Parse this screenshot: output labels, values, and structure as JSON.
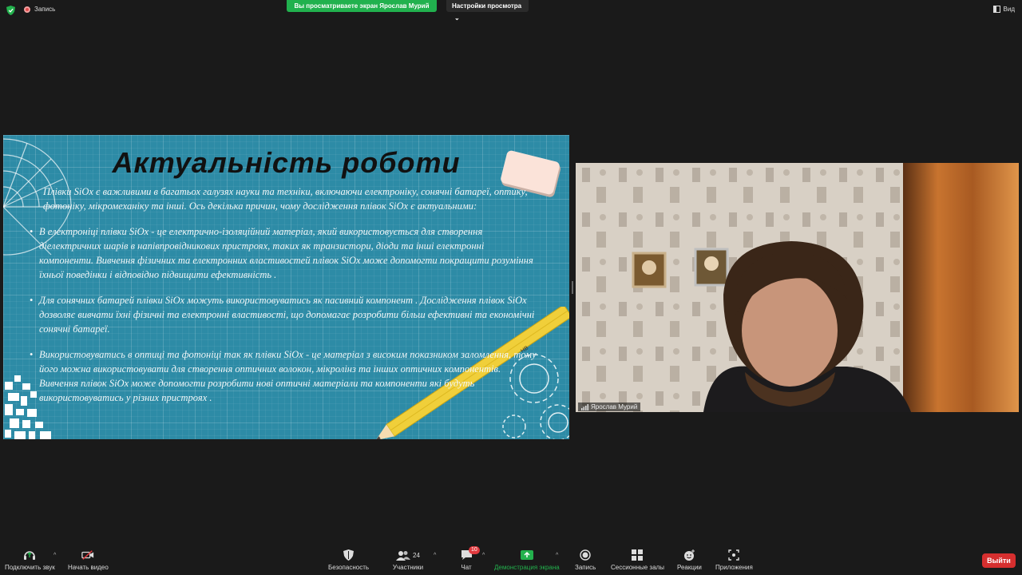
{
  "topbar": {
    "recording_label": "Запись",
    "share_banner": "Вы просматриваете экран Ярослав Мурий",
    "view_options_label": "Настройки просмотра",
    "view_label": "Вид"
  },
  "slide": {
    "title": "Актуальність  роботи",
    "intro": "Плівки SiOx є важливими в багатьох галузях науки та техніки, включаючи електроніку, сонячні батареї, оптику, фотоніку, мікромеханіку та інші. Ось декілька причин, чому дослідження плівок SiOx є актуальними:",
    "bullet_1": "В електроніці плівки  SiOx - це електрично-ізоляційний матеріал, який використовується для створення діелектричних шарів в напівпровідникових пристроях, таких як транзистори, діоди та інші електронні компоненти. Вивчення фізичних та електронних властивостей плівок SiOx може допомогти покращити розуміння їхньої поведінки і відповідно підвищити ефективність .",
    "bullet_2": "Для сонячних батарей плівки SiOx можуть використовуватись як пасивний компонент . Дослідження плівок SiOx дозволяє вивчати їхні фізичні та електронні властивості, що допомагає розробити більш ефективні та економічні сонячні батареї.",
    "bullet_3": "Використовуватись в оптиці та фотоніці так як плівки SiOx - це матеріал з високим показником заломлення, тому його можна використовувати для створення оптичних волокон, мікролінз та інших оптичних компонентів. Вивчення плівок SiOx може допомогти розробити нові оптичні матеріали та компоненти які будуть використовуватись у різних пристроях .",
    "pencil_label": "HB"
  },
  "video": {
    "participant_name": "Ярослав Мурий"
  },
  "toolbar": {
    "audio_label": "Подключить звук",
    "video_label": "Начать видео",
    "security_label": "Безопасность",
    "participants_label": "Участники",
    "participants_count": "24",
    "chat_label": "Чат",
    "chat_badge": "10",
    "share_label": "Демонстрация экрана",
    "record_label": "Запись",
    "breakout_label": "Сессионные залы",
    "reactions_label": "Реакции",
    "apps_label": "Приложения",
    "leave_label": "Выйти"
  },
  "colors": {
    "share_green": "#21b14e",
    "leave_red": "#d62f2f",
    "slide_teal": "#2d8ba6"
  }
}
